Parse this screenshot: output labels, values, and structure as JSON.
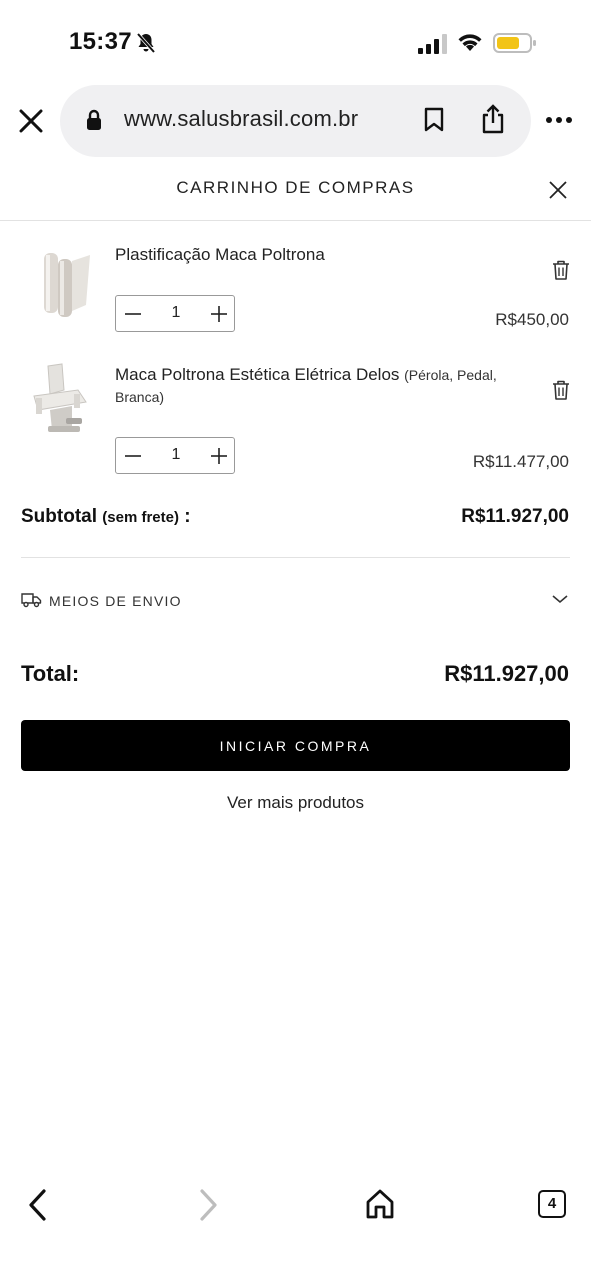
{
  "status_bar": {
    "time": "15:37"
  },
  "browser": {
    "url": "www.salusbrasil.com.br",
    "tab_count": "4"
  },
  "cart": {
    "title": "CARRINHO DE COMPRAS",
    "items": [
      {
        "name": "Plastificação Maca Poltrona",
        "variant": "",
        "quantity": "1",
        "price": "R$450,00"
      },
      {
        "name": "Maca Poltrona Estética Elétrica Delos",
        "variant": "(Pérola, Pedal, Branca)",
        "quantity": "1",
        "price": "R$11.477,00"
      }
    ],
    "subtotal_label": "Subtotal",
    "subtotal_note": "(sem frete)",
    "subtotal_colon": " :",
    "subtotal_value": "R$11.927,00",
    "shipping_label": "MEIOS DE ENVIO",
    "total_label": "Total:",
    "total_value": "R$11.927,00",
    "checkout_label": "INICIAR COMPRA",
    "more_products_label": "Ver mais produtos"
  }
}
